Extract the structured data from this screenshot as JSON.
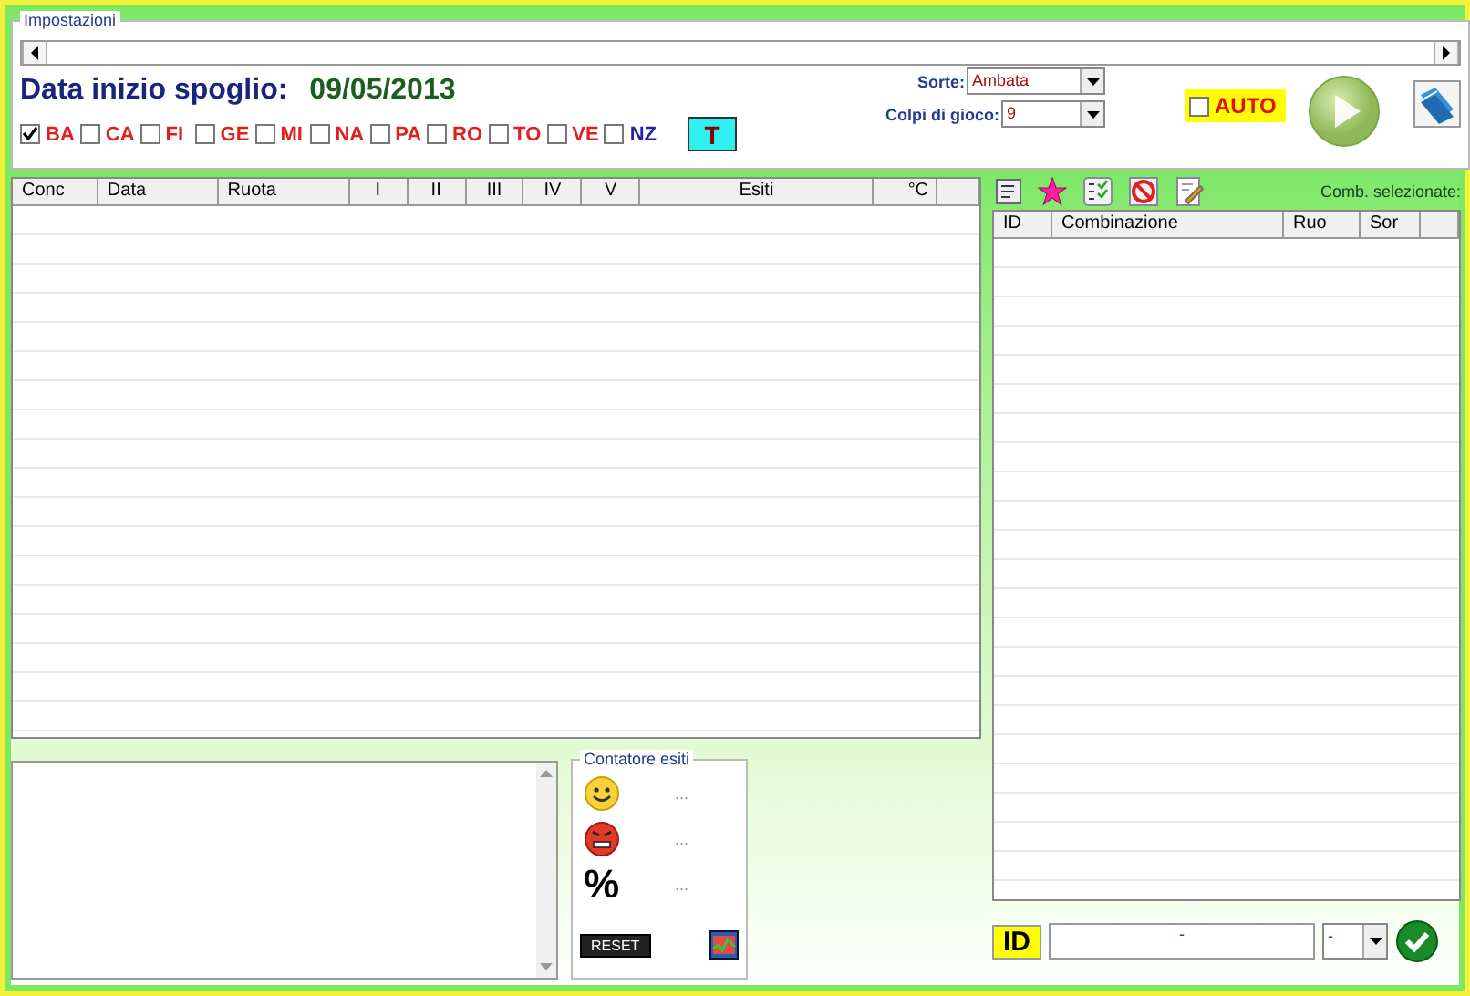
{
  "settings": {
    "legend": "Impostazioni",
    "date_label": "Data inizio spoglio:",
    "date_value": "09/05/2013",
    "wheels": [
      {
        "label": "BA",
        "checked": true
      },
      {
        "label": "CA",
        "checked": false
      },
      {
        "label": "FI",
        "checked": false
      },
      {
        "label": "GE",
        "checked": false
      },
      {
        "label": "MI",
        "checked": false
      },
      {
        "label": "NA",
        "checked": false
      },
      {
        "label": "PA",
        "checked": false
      },
      {
        "label": "RO",
        "checked": false
      },
      {
        "label": "TO",
        "checked": false
      },
      {
        "label": "VE",
        "checked": false
      },
      {
        "label": "NZ",
        "checked": false
      }
    ],
    "t_button": "T",
    "sorte": {
      "label": "Sorte:",
      "value": "Ambata"
    },
    "colpi": {
      "label": "Colpi di gioco:",
      "value": "9"
    },
    "auto": {
      "label": "AUTO",
      "checked": false
    }
  },
  "results_table": {
    "columns": [
      "Conc",
      "Data",
      "Ruota",
      "I",
      "II",
      "III",
      "IV",
      "V",
      "Esiti",
      "°C"
    ]
  },
  "counter": {
    "legend": "Contatore esiti",
    "rows": [
      {
        "kind": "smile",
        "value": "..."
      },
      {
        "kind": "angry",
        "value": "..."
      },
      {
        "kind": "percent",
        "symbol": "%",
        "value": "..."
      }
    ],
    "reset": "RESET"
  },
  "combinations": {
    "label": "Comb. selezionate:",
    "columns": [
      "ID",
      "Combinazione",
      "Ruo",
      "Sor"
    ]
  },
  "id_bar": {
    "label": "ID",
    "value": "-",
    "select": "-"
  }
}
